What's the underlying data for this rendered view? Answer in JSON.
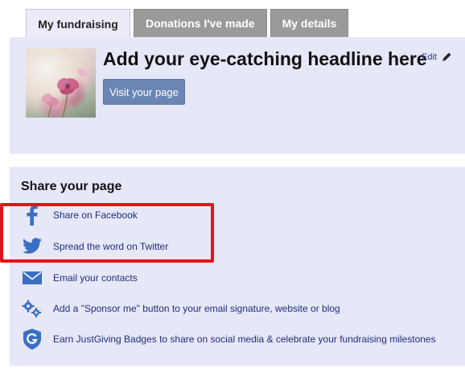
{
  "tabs": [
    {
      "label": "My fundraising",
      "active": true
    },
    {
      "label": "Donations I've made",
      "active": false
    },
    {
      "label": "My details",
      "active": false
    }
  ],
  "headline_panel": {
    "headline": "Add your eye-catching headline here",
    "edit_label": "Edit",
    "visit_button": "Visit your page",
    "edit_icon": "pencil-icon"
  },
  "share": {
    "title": "Share your page",
    "items": [
      {
        "label": "Share on Facebook",
        "icon": "facebook-icon"
      },
      {
        "label": "Spread the word on Twitter",
        "icon": "twitter-icon"
      },
      {
        "label": "Email your contacts",
        "icon": "email-icon"
      },
      {
        "label": "Add a \"Sponsor me\" button to your email signature, website or blog",
        "icon": "gears-icon"
      },
      {
        "label": "Earn JustGiving Badges to share on social media & celebrate your fundraising milestones",
        "icon": "badge-icon"
      }
    ]
  },
  "colors": {
    "panel_bg": "#e6e7f7",
    "link": "#1f2f7a",
    "button": "#6b86b4",
    "highlight": "#e6121a",
    "icon_blue": "#3b6fc4"
  }
}
